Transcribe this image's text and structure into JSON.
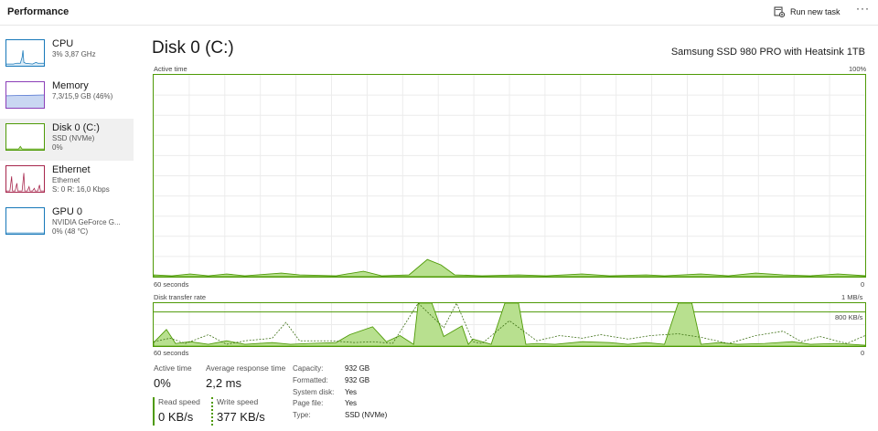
{
  "header": {
    "title": "Performance",
    "run_task_label": "Run new task",
    "more": "···"
  },
  "sidebar": {
    "items": [
      {
        "name": "CPU",
        "sub1": "3% 3,87 GHz",
        "sub2": ""
      },
      {
        "name": "Memory",
        "sub1": "7,3/15,9 GB (46%)",
        "sub2": ""
      },
      {
        "name": "Disk 0 (C:)",
        "sub1": "SSD (NVMe)",
        "sub2": "0%"
      },
      {
        "name": "Ethernet",
        "sub1": "Ethernet",
        "sub2": "S: 0 R: 16,0 Kbps"
      },
      {
        "name": "GPU 0",
        "sub1": "NVIDIA GeForce G...",
        "sub2": "0% (48 °C)"
      }
    ]
  },
  "disk": {
    "title": "Disk 0 (C:)",
    "model": "Samsung SSD 980 PRO with Heatsink 1TB"
  },
  "active_graph": {
    "label": "Active time",
    "max": "100%",
    "time": "60 seconds",
    "min": "0"
  },
  "transfer_graph": {
    "label": "Disk transfer rate",
    "max": "1 MB/s",
    "mid": "800 KB/s",
    "time": "60 seconds",
    "min": "0"
  },
  "stats": {
    "active_time_label": "Active time",
    "active_time": "0%",
    "response_label": "Average response time",
    "response": "2,2 ms",
    "read_label": "Read speed",
    "read": "0 KB/s",
    "write_label": "Write speed",
    "write": "377 KB/s"
  },
  "props": [
    {
      "k": "Capacity:",
      "v": "932 GB"
    },
    {
      "k": "Formatted:",
      "v": "932 GB"
    },
    {
      "k": "System disk:",
      "v": "Yes"
    },
    {
      "k": "Page file:",
      "v": "Yes"
    },
    {
      "k": "Type:",
      "v": "SSD (NVMe)"
    }
  ],
  "colors": {
    "disk": "#4e9a06",
    "disk_fill": "#b8e08f",
    "cpu": "#1778b9",
    "memory": "#8b3fb8",
    "ethernet": "#a7264c",
    "gpu": "#1778b9"
  }
}
